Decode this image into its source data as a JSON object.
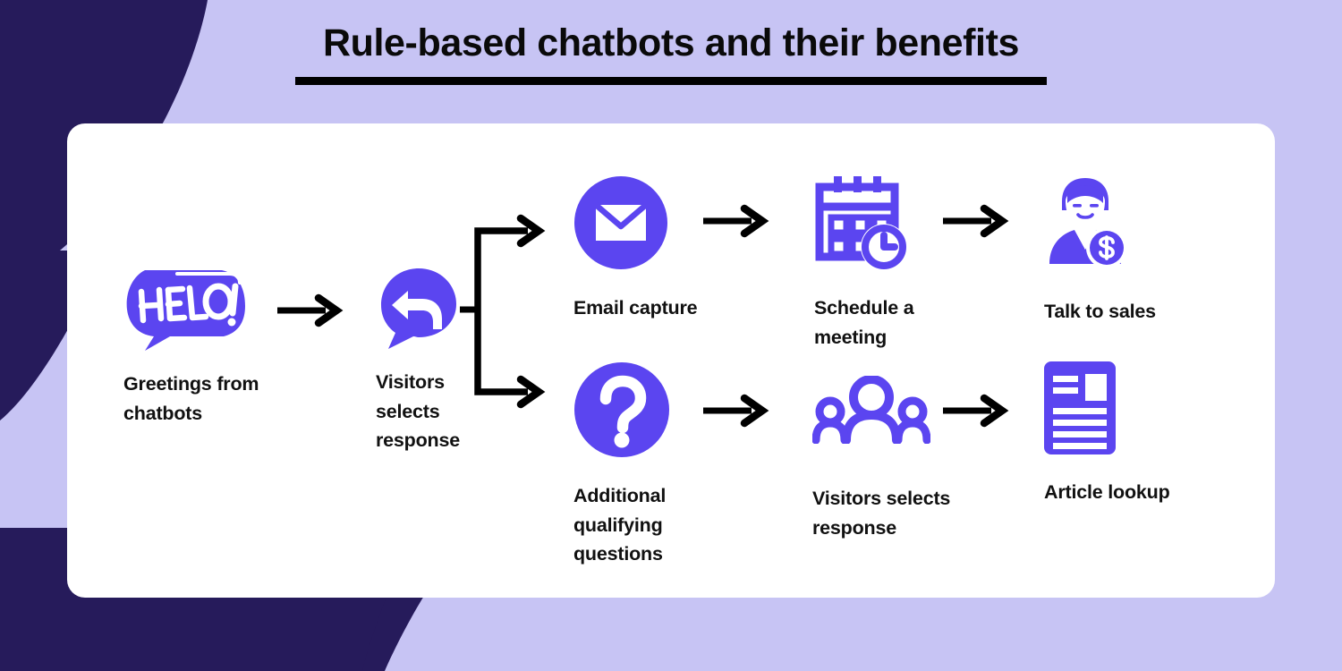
{
  "header": {
    "title": "Rule-based chatbots and their benefits"
  },
  "theme": {
    "background": "#c7c4f4",
    "navy": "#261b5b",
    "card": "#ffffff",
    "accent_purple": "#5b45f0",
    "text": "#111111",
    "arrow": "#000000"
  },
  "flow": {
    "start": {
      "icon": "hello-speech-bubble-icon",
      "label": "Greetings from chatbots"
    },
    "decision": {
      "icon": "reply-speech-bubble-icon",
      "label": "Visitors selects response"
    },
    "branches": [
      {
        "name": "top-branch",
        "steps": [
          {
            "icon": "email-envelope-icon",
            "label": "Email capture"
          },
          {
            "icon": "calendar-clock-icon",
            "label": "Schedule a meeting"
          },
          {
            "icon": "sales-agent-icon",
            "label": "Talk to sales"
          }
        ]
      },
      {
        "name": "bottom-branch",
        "steps": [
          {
            "icon": "question-mark-icon",
            "label": "Additional qualifying questions"
          },
          {
            "icon": "people-group-icon",
            "label": "Visitors selects response"
          },
          {
            "icon": "article-document-icon",
            "label": "Article lookup"
          }
        ]
      }
    ],
    "connectors": {
      "start_to_decision": "arrow-right-icon",
      "split": "branch-split-icon",
      "top_step1_to_step2": "arrow-right-icon",
      "top_step2_to_step3": "arrow-right-icon",
      "bottom_step1_to_step2": "arrow-right-icon",
      "bottom_step2_to_step3": "arrow-right-icon"
    },
    "hello_bubble_text": "HELLO!"
  }
}
